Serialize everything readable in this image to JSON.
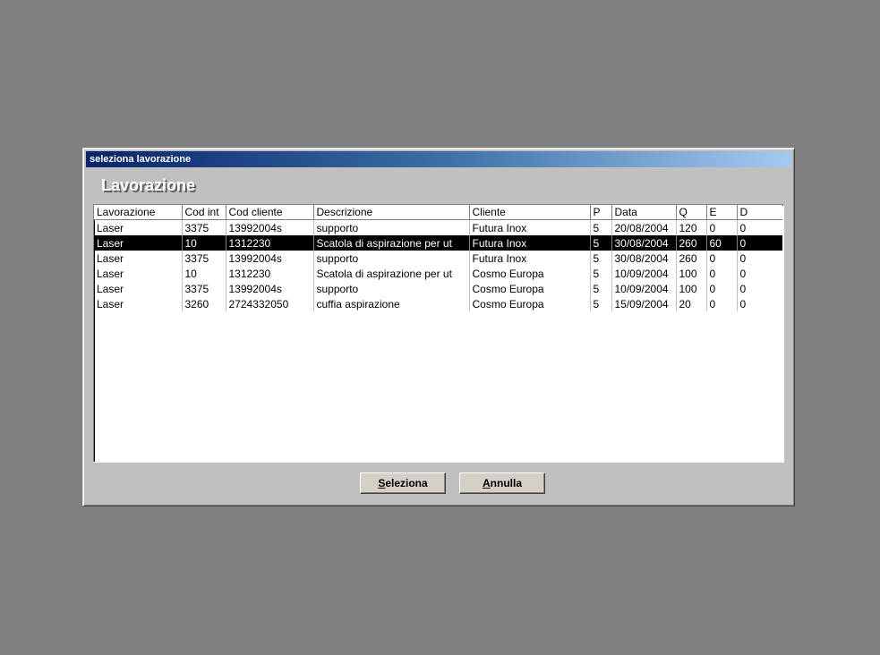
{
  "window": {
    "title": "seleziona lavorazione"
  },
  "heading": "Lavorazione",
  "columns": [
    "Lavorazione",
    "Cod int",
    "Cod cliente",
    "Descrizione",
    "Cliente",
    "P",
    "Data",
    "Q",
    "E",
    "D"
  ],
  "rows": [
    [
      "Laser",
      "3375",
      "13992004s",
      "supporto",
      "Futura Inox",
      "5",
      "20/08/2004",
      "120",
      "0",
      "0"
    ],
    [
      "Laser",
      "10",
      "1312230",
      "Scatola di aspirazione per ut",
      "Futura Inox",
      "5",
      "30/08/2004",
      "260",
      "60",
      "0"
    ],
    [
      "Laser",
      "3375",
      "13992004s",
      "supporto",
      "Futura Inox",
      "5",
      "30/08/2004",
      "260",
      "0",
      "0"
    ],
    [
      "Laser",
      "10",
      "1312230",
      "Scatola di aspirazione per ut",
      "Cosmo Europa",
      "5",
      "10/09/2004",
      "100",
      "0",
      "0"
    ],
    [
      "Laser",
      "3375",
      "13992004s",
      "supporto",
      "Cosmo Europa",
      "5",
      "10/09/2004",
      "100",
      "0",
      "0"
    ],
    [
      "Laser",
      "3260",
      "2724332050",
      "cuffia aspirazione",
      "Cosmo Europa",
      "5",
      "15/09/2004",
      "20",
      "0",
      "0"
    ]
  ],
  "selected_row": 1,
  "buttons": {
    "seleziona": {
      "accel": "S",
      "rest": "eleziona"
    },
    "annulla": {
      "accel": "A",
      "rest": "nnulla"
    }
  },
  "colors": {
    "desktop": "#808080",
    "dialog": "#c0c0c0",
    "title_gradient_start": "#0a246a",
    "title_gradient_end": "#a6caf0",
    "selection": "#000000"
  }
}
